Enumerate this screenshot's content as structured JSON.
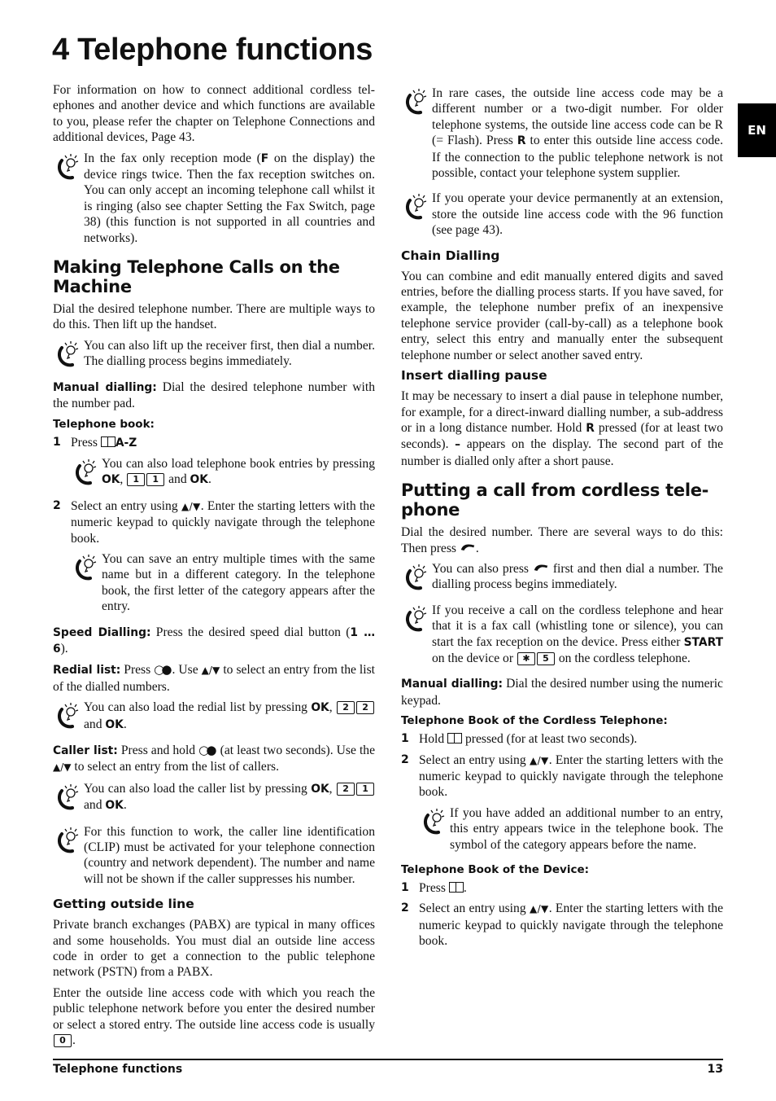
{
  "page": {
    "title": "4 Telephone functions",
    "language_tab": "EN",
    "footer": {
      "section": "Telephone functions",
      "page_number": "13"
    }
  },
  "left_column": [
    {
      "type": "p",
      "segs": [
        {
          "t": "For information on how to connect additional cordless tel­ephones and another device and which functions are avail­able to you, please refer the chapter on Telephone Connec­tions and additional devices, Page 43."
        }
      ]
    },
    {
      "type": "tip",
      "segs": [
        {
          "t": "In the fax only reception mode ("
        },
        {
          "b": "F"
        },
        {
          "t": " on the display) the device rings twice. Then the fax reception switches on. You can only accept an incoming telephone call whilst it is ringing (also see chapter Setting the Fax Switch, page 38) (this function is not supported in all countries and networks)."
        }
      ]
    },
    {
      "type": "h2",
      "text": "Making Telephone Calls on the Machine"
    },
    {
      "type": "p",
      "segs": [
        {
          "t": "Dial the desired telephone number. There are multiple ways to do this. Then lift up the handset."
        }
      ]
    },
    {
      "type": "tip",
      "segs": [
        {
          "t": "You can also lift up the receiver first, then dial a number. The dialling process begins immediately."
        }
      ]
    },
    {
      "type": "p",
      "segs": [
        {
          "b": "Manual dialling:"
        },
        {
          "t": " Dial the desired telephone number with the number pad."
        }
      ]
    },
    {
      "type": "h4",
      "text": "Telephone book:"
    },
    {
      "type": "step",
      "num": "1",
      "segs": [
        {
          "t": "Press "
        },
        {
          "icon": "book"
        },
        {
          "b": "A-Z"
        }
      ]
    },
    {
      "type": "tip",
      "indent": true,
      "segs": [
        {
          "t": "You can also load telephone book entries by pressing "
        },
        {
          "b": "OK"
        },
        {
          "t": ", "
        },
        {
          "key": "1"
        },
        {
          "key": "1"
        },
        {
          "t": " and "
        },
        {
          "b": "OK"
        },
        {
          "t": "."
        }
      ]
    },
    {
      "type": "step",
      "num": "2",
      "segs": [
        {
          "t": "Select an entry using "
        },
        {
          "glyph": "▲/▼"
        },
        {
          "t": ". Enter the starting letters with the numeric keypad to quickly navigate through the tel­ephone book."
        }
      ]
    },
    {
      "type": "tip",
      "indent": true,
      "segs": [
        {
          "t": "You can save an entry multiple times with the same name but in a different category. In the tel­ephone book, the first letter of the category ap­pears after the entry."
        }
      ]
    },
    {
      "type": "p",
      "segs": [
        {
          "b": "Speed Dialling:"
        },
        {
          "t": " Press the desired speed dial button ("
        },
        {
          "b": "1 … 6"
        },
        {
          "t": ")."
        }
      ]
    },
    {
      "type": "p",
      "segs": [
        {
          "b": "Redial list:"
        },
        {
          "t": " Press "
        },
        {
          "icon": "redial"
        },
        {
          "t": ". Use "
        },
        {
          "glyph": "▲/▼"
        },
        {
          "t": " to select an entry from the list of the dialled numbers."
        }
      ]
    },
    {
      "type": "tip",
      "segs": [
        {
          "t": "You can also load the redial list by pressing "
        },
        {
          "b": "OK"
        },
        {
          "t": ", "
        },
        {
          "key": "2"
        },
        {
          "key": "2"
        },
        {
          "t": " and "
        },
        {
          "b": "OK"
        },
        {
          "t": "."
        }
      ]
    },
    {
      "type": "p",
      "segs": [
        {
          "b": "Caller list:"
        },
        {
          "t": " Press and hold "
        },
        {
          "icon": "redial"
        },
        {
          "t": " (at least two seconds). Use the "
        },
        {
          "glyph": "▲/▼"
        },
        {
          "t": " to select an entry from the list of callers."
        }
      ]
    },
    {
      "type": "tip",
      "segs": [
        {
          "t": "You can also load the caller list by pressing "
        },
        {
          "b": "OK"
        },
        {
          "t": ", "
        },
        {
          "key": "2"
        },
        {
          "key": "1"
        },
        {
          "t": " and "
        },
        {
          "b": "OK"
        },
        {
          "t": "."
        }
      ]
    },
    {
      "type": "tip",
      "segs": [
        {
          "t": "For this function to work, the caller line identifica­tion (CLIP) must be activated for your telephone connection (country and network dependent). The number and name will not be shown if the caller sup­presses his number."
        }
      ]
    },
    {
      "type": "h3",
      "text": "Getting outside line"
    },
    {
      "type": "p",
      "segs": [
        {
          "t": "Private branch exchanges (PABX) are typical in many of­fices and some households. You must dial an outside line access code in order to get a connection to the public tele­phone network (PSTN) from a PABX."
        }
      ]
    },
    {
      "type": "p",
      "segs": [
        {
          "t": "Enter the outside line access code with which you reach the public telephone network before you enter the desired number or select a stored entry. The outside line access code is usually "
        },
        {
          "key": "0"
        },
        {
          "t": "."
        }
      ]
    }
  ],
  "right_column": [
    {
      "type": "tip",
      "segs": [
        {
          "t": "In rare cases, the outside line access code may be a different number or a two-digit number. For older telephone systems, the outside line access code can be R (= Flash). Press "
        },
        {
          "b": "R"
        },
        {
          "t": " to enter this outside line access code. If the connection to the public telephone net­work is not possible, contact your telephone system supplier."
        }
      ]
    },
    {
      "type": "tip",
      "segs": [
        {
          "t": "If you operate your device permanently at an exten­sion, store the outside line access code with the 96 function (see page 43)."
        }
      ]
    },
    {
      "type": "h3",
      "text": "Chain Dialling"
    },
    {
      "type": "p",
      "segs": [
        {
          "t": "You can combine and edit manually entered digits and saved entries, before the dialling process starts. If you have saved, for example, the telephone number prefix of an in­expensive telephone service provider (call-by-call) as a tel­ephone book entry, select this entry and manually enter the subsequent telephone number or select another saved entry."
        }
      ]
    },
    {
      "type": "h3",
      "text": "Insert dialling pause"
    },
    {
      "type": "p",
      "segs": [
        {
          "t": "It may be necessary to insert a dial pause in telephone number, for example, for a direct-inward dialling number, a sub-address or in a long distance number. Hold "
        },
        {
          "b": "R"
        },
        {
          "t": " pressed (for at least two seconds). "
        },
        {
          "b": "–"
        },
        {
          "t": " appears on the display. The second part of the number is dialled only after a short pause."
        }
      ]
    },
    {
      "type": "h2",
      "text": "Putting a call from cordless tele­phone"
    },
    {
      "type": "p",
      "segs": [
        {
          "t": "Dial the desired number. There are several ways to do this: Then press "
        },
        {
          "icon": "handset"
        },
        {
          "t": "."
        }
      ]
    },
    {
      "type": "tip",
      "segs": [
        {
          "t": "You can also press "
        },
        {
          "icon": "handset"
        },
        {
          "t": " first and then dial a number. The dialling process begins immediately."
        }
      ]
    },
    {
      "type": "tip",
      "segs": [
        {
          "t": "If you receive a call on the cordless telephone and hear that it is a fax call (whistling tone or silence), you can start the fax reception on the device. Press either "
        },
        {
          "b": "START"
        },
        {
          "t": " on the device or "
        },
        {
          "key": "✱"
        },
        {
          "key": "5"
        },
        {
          "t": " on the cordless telephone."
        }
      ]
    },
    {
      "type": "p",
      "segs": [
        {
          "b": "Manual dialling:"
        },
        {
          "t": " Dial the desired number using the nu­meric keypad."
        }
      ]
    },
    {
      "type": "h4",
      "text": "Telephone Book of the Cordless Telephone:"
    },
    {
      "type": "step",
      "num": "1",
      "segs": [
        {
          "t": "Hold "
        },
        {
          "icon": "book"
        },
        {
          "t": " pressed (for at least two seconds)."
        }
      ]
    },
    {
      "type": "step",
      "num": "2",
      "segs": [
        {
          "t": "Select an entry using "
        },
        {
          "glyph": "▲/▼"
        },
        {
          "t": ". Enter the starting letters with the numeric keypad to quickly navigate through the tel­ephone book."
        }
      ]
    },
    {
      "type": "tip",
      "indent": true,
      "segs": [
        {
          "t": "If you have added an additional number to an en­try, this entry appears twice in the telephone book. The symbol of the category appears before the name."
        }
      ]
    },
    {
      "type": "h4",
      "text": "Telephone Book of the Device:"
    },
    {
      "type": "step",
      "num": "1",
      "segs": [
        {
          "t": "Press "
        },
        {
          "icon": "book"
        },
        {
          "t": "."
        }
      ]
    },
    {
      "type": "step",
      "num": "2",
      "segs": [
        {
          "t": "Select an entry using "
        },
        {
          "glyph": "▲/▼"
        },
        {
          "t": ". Enter the starting letters with the numeric keypad to quickly navigate through the tel­ephone book."
        }
      ]
    }
  ]
}
